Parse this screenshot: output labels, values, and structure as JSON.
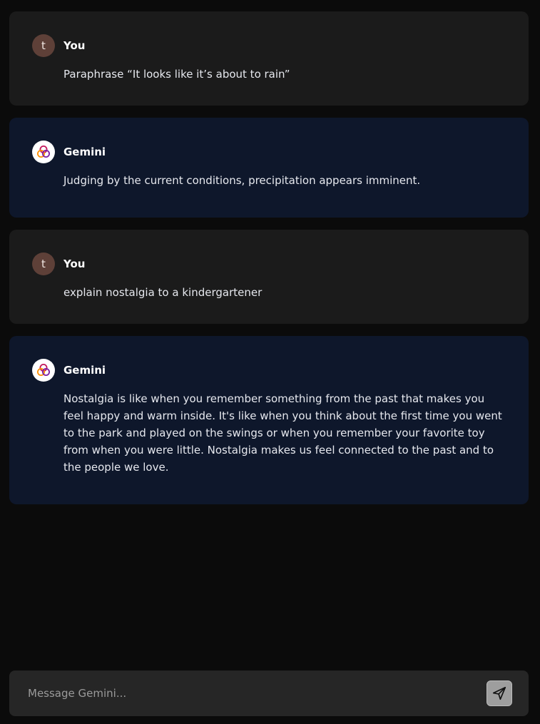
{
  "conversation": [
    {
      "role": "user",
      "avatar_letter": "t",
      "author": "You",
      "text": "Paraphrase “It looks like it’s about to rain”"
    },
    {
      "role": "bot",
      "avatar_icon": "gemini-logo-icon",
      "author": "Gemini",
      "text": "Judging by the current conditions, precipitation appears imminent."
    },
    {
      "role": "user",
      "avatar_letter": "t",
      "author": "You",
      "text": "explain nostalgia to a kindergartener"
    },
    {
      "role": "bot",
      "avatar_icon": "gemini-logo-icon",
      "author": "Gemini",
      "text": "Nostalgia is like when you remember something from the past that makes you feel happy and warm inside. It's like when you think about the first time you went to the park and played on the swings or when you remember your favorite toy from when you were little. Nostalgia makes us feel connected to the past and to the people we love."
    }
  ],
  "composer": {
    "placeholder": "Message Gemini...",
    "value": "",
    "send_icon": "send-icon"
  },
  "colors": {
    "page_bg": "#0b0b0b",
    "user_bubble": "#1b1b1b",
    "bot_bubble": "#0e172b",
    "user_avatar": "#5e4038",
    "logo_magenta": "#c2185b",
    "logo_orange": "#ff8f00",
    "logo_purple": "#7b1fa2"
  }
}
